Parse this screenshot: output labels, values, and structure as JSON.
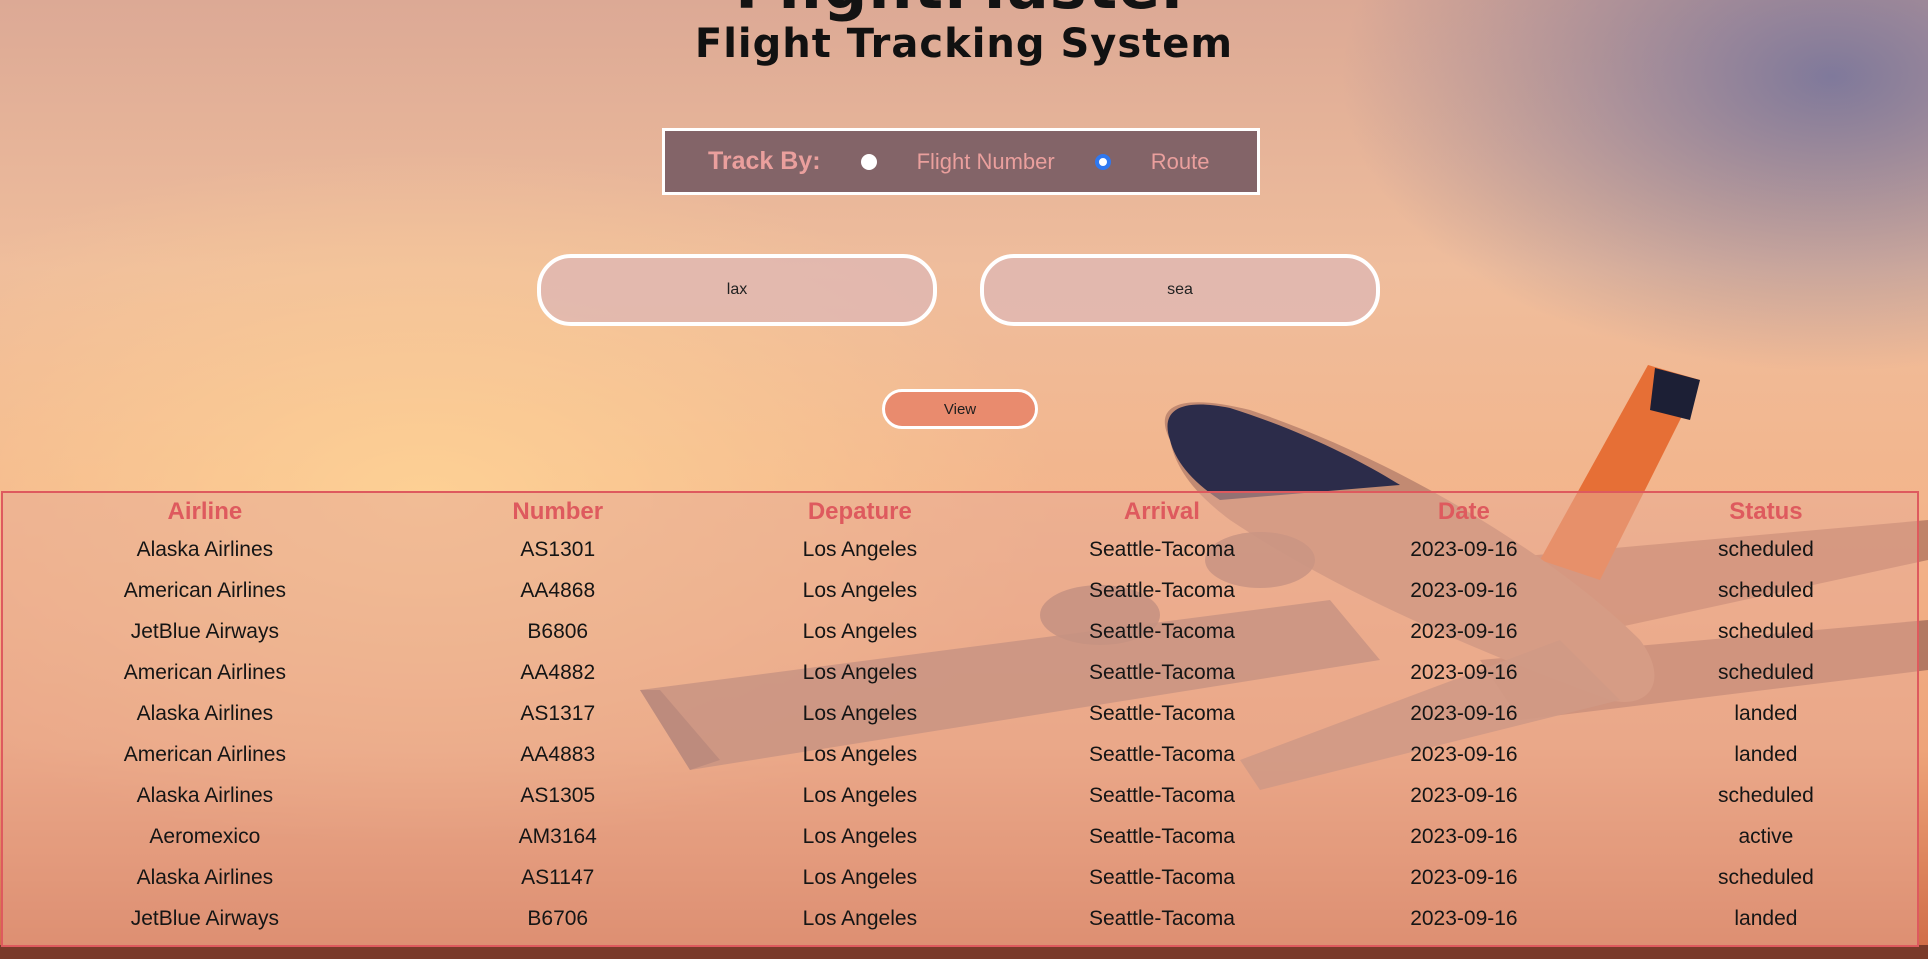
{
  "header": {
    "brand": "FlightMaster",
    "subtitle": "Flight Tracking System"
  },
  "track_by": {
    "label": "Track By:",
    "options": [
      {
        "label": "Flight Number",
        "selected": false
      },
      {
        "label": "Route",
        "selected": true
      }
    ]
  },
  "route_form": {
    "from_value": "lax",
    "to_value": "sea",
    "submit_label": "View"
  },
  "results": {
    "columns": [
      "Airline",
      "Number",
      "Depature",
      "Arrival",
      "Date",
      "Status"
    ],
    "rows": [
      [
        "Alaska Airlines",
        "AS1301",
        "Los Angeles",
        "Seattle-Tacoma",
        "2023-09-16",
        "scheduled"
      ],
      [
        "American Airlines",
        "AA4868",
        "Los Angeles",
        "Seattle-Tacoma",
        "2023-09-16",
        "scheduled"
      ],
      [
        "JetBlue Airways",
        "B6806",
        "Los Angeles",
        "Seattle-Tacoma",
        "2023-09-16",
        "scheduled"
      ],
      [
        "American Airlines",
        "AA4882",
        "Los Angeles",
        "Seattle-Tacoma",
        "2023-09-16",
        "scheduled"
      ],
      [
        "Alaska Airlines",
        "AS1317",
        "Los Angeles",
        "Seattle-Tacoma",
        "2023-09-16",
        "landed"
      ],
      [
        "American Airlines",
        "AA4883",
        "Los Angeles",
        "Seattle-Tacoma",
        "2023-09-16",
        "landed"
      ],
      [
        "Alaska Airlines",
        "AS1305",
        "Los Angeles",
        "Seattle-Tacoma",
        "2023-09-16",
        "scheduled"
      ],
      [
        "Aeromexico",
        "AM3164",
        "Los Angeles",
        "Seattle-Tacoma",
        "2023-09-16",
        "active"
      ],
      [
        "Alaska Airlines",
        "AS1147",
        "Los Angeles",
        "Seattle-Tacoma",
        "2023-09-16",
        "scheduled"
      ],
      [
        "JetBlue Airways",
        "B6706",
        "Los Angeles",
        "Seattle-Tacoma",
        "2023-09-16",
        "landed"
      ]
    ]
  },
  "colors": {
    "accent": "#de5a5e",
    "track_label": "#ea9f9d",
    "radio_selected": "#2f78f0",
    "button": "#e98b6e"
  },
  "icons": {
    "background": "airplane-photo"
  }
}
